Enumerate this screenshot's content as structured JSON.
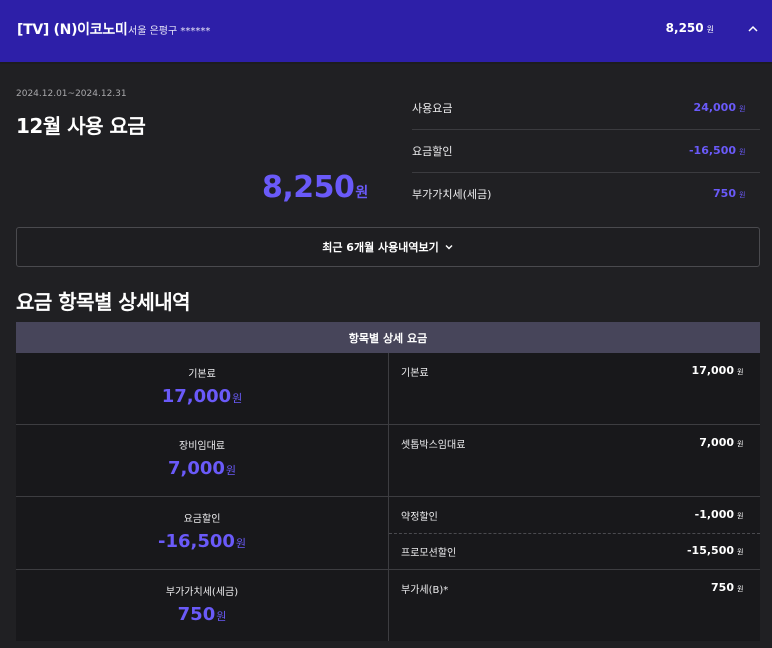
{
  "header": {
    "product": "[TV] (N)이코노미",
    "address": "서울 은평구 ******",
    "amount": "8,250",
    "unit": "원",
    "collapse_icon": "chevron-up-icon"
  },
  "bill": {
    "period": "2024.12.01~2024.12.31",
    "title": "12월 사용 요금",
    "total": "8,250",
    "unit": "원"
  },
  "summary": [
    {
      "label": "사용요금",
      "value": "24,000",
      "unit": "원"
    },
    {
      "label": "요금할인",
      "value": "-16,500",
      "unit": "원"
    },
    {
      "label": "부가가치세(세금)",
      "value": "750",
      "unit": "원"
    }
  ],
  "history_button": {
    "label": "최근 6개월 사용내역보기",
    "icon": "chevron-down-icon"
  },
  "details": {
    "section_title": "요금 항목별 상세내역",
    "table_header": "항목별 상세 요금",
    "categories": [
      {
        "name": "기본료",
        "amount": "17,000",
        "unit": "원",
        "items": [
          {
            "label": "기본료",
            "value": "17,000",
            "unit": "원"
          }
        ]
      },
      {
        "name": "장비임대료",
        "amount": "7,000",
        "unit": "원",
        "items": [
          {
            "label": "셋톱박스임대료",
            "value": "7,000",
            "unit": "원"
          }
        ]
      },
      {
        "name": "요금할인",
        "amount": "-16,500",
        "unit": "원",
        "items": [
          {
            "label": "약정할인",
            "value": "-1,000",
            "unit": "원"
          },
          {
            "label": "프로모션할인",
            "value": "-15,500",
            "unit": "원"
          }
        ]
      },
      {
        "name": "부가가치세(세금)",
        "amount": "750",
        "unit": "원",
        "items": [
          {
            "label": "부가세(B)*",
            "value": "750",
            "unit": "원"
          }
        ]
      }
    ]
  },
  "colors": {
    "header_bg": "#2d1fa8",
    "accent": "#6a5af9",
    "page_bg": "#202023",
    "table_head_bg": "#47455a"
  }
}
